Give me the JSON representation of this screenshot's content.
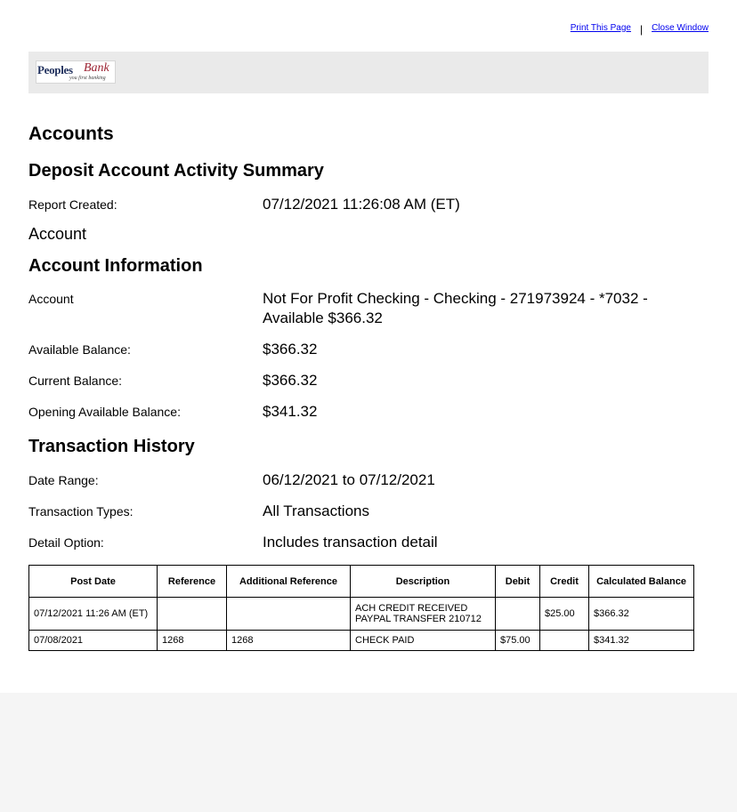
{
  "top_links": {
    "print": "Print This Page",
    "separator": "|",
    "close": "Close Window"
  },
  "logo": {
    "peoples": "Peoples",
    "bank": "Bank",
    "tagline": "you first banking",
    "colors": {
      "primary": "#1f2f5c",
      "accent": "#9b2131"
    }
  },
  "headings": {
    "accounts": "Accounts",
    "summary": "Deposit Account Activity Summary",
    "account_info": "Account Information",
    "history": "Transaction History"
  },
  "report": {
    "label": "Report Created:",
    "value": "07/12/2021 11:26:08 AM (ET)"
  },
  "account_plain": "Account",
  "account_info": {
    "account_label": "Account",
    "account_value": "Not For Profit Checking - Checking - 271973924 - *7032 - Available $366.32",
    "available_label": "Available Balance:",
    "available_value": "$366.32",
    "current_label": "Current Balance:",
    "current_value": "$366.32",
    "opening_label": "Opening Available Balance:",
    "opening_value": "$341.32"
  },
  "history": {
    "range_label": "Date Range:",
    "range_value": "06/12/2021 to 07/12/2021",
    "types_label": "Transaction Types:",
    "types_value": "All Transactions",
    "detail_label": "Detail Option:",
    "detail_value": "Includes transaction detail"
  },
  "table": {
    "headers": [
      "Post Date",
      "Reference",
      "Additional Reference",
      "Description",
      "Debit",
      "Credit",
      "Calculated Balance"
    ],
    "rows": [
      {
        "post_date": "07/12/2021 11:26 AM (ET)",
        "reference": "",
        "additional_reference": "",
        "description_line1": "ACH CREDIT RECEIVED",
        "description_line2": "PAYPAL TRANSFER 210712",
        "debit": "",
        "credit": "$25.00",
        "balance": "$366.32"
      },
      {
        "post_date": "07/08/2021",
        "reference": "1268",
        "additional_reference": "1268",
        "description_line1": "CHECK PAID",
        "description_line2": "",
        "debit": "$75.00",
        "credit": "",
        "balance": "$341.32"
      }
    ]
  }
}
